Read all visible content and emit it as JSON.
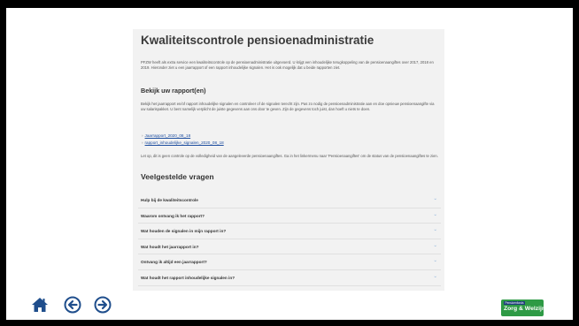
{
  "article": {
    "title": "Kwaliteitscontrole pensioenadministratie",
    "intro": "PFZW heeft als extra service een kwaliteitscontrole op de pensioenadministratie uitgevoerd. U krijgt een inhoudelijke terugkoppeling van de pensioenaangiftes over 2017, 2018 en 2019. Hieronder ziet u een jaarrapport of een rapport inhoudelijke signalen. Het is ook mogelijk dat u beide rapporten ziet.",
    "section_heading": "Bekijk uw rapport(en)",
    "section_text": "Bekijk het jaarrapport en/of rapport inhoudelijke signalen en controleer of de signalen terecht zijn. Pas zo nodig de pensioenadministratie aan en doe opnieuw pensioenaangifte via uw salarispakket. U bent namelijk verplicht de juiste gegevens aan ons door te geven. Zijn de gegevens toch juist, dan hoeft u niets te doen.",
    "links": [
      {
        "label": "Jaarrapport_2020_08_18"
      },
      {
        "label": "rapport_inhoudelijke_signalen_2020_08_18"
      }
    ],
    "note": "Let op, dit is geen controle op de volledigheid van de aangeleverde pensioenaangiftes. Ga in het linkermenu naar 'Pensioenaangiftes' om de status van de pensioenaangiftes te zien.",
    "faq_heading": "Veelgestelde vragen",
    "faq": [
      {
        "question": "Hulp bij de kwaliteitscontrole"
      },
      {
        "question": "Waarom ontvang ik het rapport?"
      },
      {
        "question": "Wat houden de signalen in mijn rapport in?"
      },
      {
        "question": "Wat houdt het jaarrapport in?"
      },
      {
        "question": "Ontvang ik altijd een jaarrapport?"
      },
      {
        "question": "Wat houdt het rapport inhoudelijke signalen in?"
      }
    ]
  },
  "nav": {
    "home_icon": "home-icon",
    "back_icon": "arrow-left-circle-icon",
    "forward_icon": "arrow-right-circle-icon",
    "icon_color": "#1f4e8c"
  },
  "brand": {
    "small_text": "Pensioenfonds",
    "name": "Zorg & Welzijn",
    "color": "#2e9a45"
  }
}
